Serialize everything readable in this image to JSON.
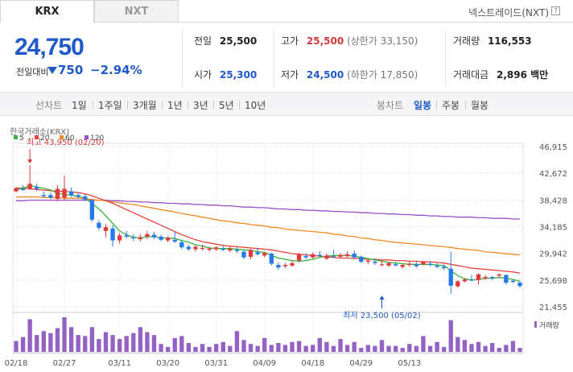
{
  "tabs": {
    "krx": "KRX",
    "nxt": "NXT"
  },
  "nxt_link": "넥스트레이드(NXT)",
  "help_icon": "?",
  "quote": {
    "price": "24,750",
    "change_label": "전일대비",
    "change": "750",
    "change_pct": "−2.94%",
    "prev_close_label": "전일",
    "prev_close": "25,500",
    "open_label": "시가",
    "open": "25,300",
    "high_label": "고가",
    "high": "25,500",
    "upper_limit": "(상한가 33,150)",
    "low_label": "저가",
    "low": "24,500",
    "lower_limit": "(하한가 17,850)",
    "volume_label": "거래량",
    "volume": "116,553",
    "amount_label": "거래대금",
    "amount": "2,896 백만"
  },
  "period_bar": {
    "line_label": "선차트",
    "line_periods": [
      "1일",
      "1주일",
      "3개월",
      "1년",
      "3년",
      "5년",
      "10년"
    ],
    "candle_label": "봉차트",
    "candle_periods": [
      "일봉",
      "주봉",
      "월봉"
    ],
    "selected_candle": "일봉"
  },
  "colors": {
    "up": "#e0393e",
    "down": "#2679e8",
    "ma5": "#37b43a",
    "ma20": "#e8443c",
    "ma60": "#f08a24",
    "ma120": "#9b4fc4",
    "volume": "#9461c4",
    "accent": "#1f5ac8"
  },
  "chart_data": {
    "type": "candlestick",
    "source_label": "한국거래소(KRX)",
    "legend": [
      {
        "label": "5",
        "color": "#37b43a"
      },
      {
        "label": "20",
        "color": "#e8443c"
      },
      {
        "label": "60",
        "color": "#f08a24"
      },
      {
        "label": "120",
        "color": "#9b4fc4"
      }
    ],
    "ylim": [
      21455,
      46915
    ],
    "y_ticks": [
      "46,915",
      "42,672",
      "38,428",
      "34,185",
      "29,942",
      "25,698",
      "21,455"
    ],
    "x_ticks": [
      {
        "label": "02/18",
        "index": 0
      },
      {
        "label": "02/27",
        "index": 7
      },
      {
        "label": "03/11",
        "index": 15
      },
      {
        "label": "03/20",
        "index": 22
      },
      {
        "label": "03/31",
        "index": 29
      },
      {
        "label": "04/09",
        "index": 36
      },
      {
        "label": "04/18",
        "index": 43
      },
      {
        "label": "04/29",
        "index": 50
      },
      {
        "label": "05/13",
        "index": 57
      }
    ],
    "high_annotation": {
      "text": "최고 43,950 (02/20)",
      "index": 2,
      "value": 43950
    },
    "low_annotation": {
      "text": "최저 23,500 (05/02)",
      "index": 53,
      "value": 23500
    },
    "volume_label": "거래량",
    "candles": [
      [
        39800,
        40500,
        39600,
        40300
      ],
      [
        40200,
        40800,
        39900,
        40000
      ],
      [
        40200,
        43950,
        40000,
        41000
      ],
      [
        40500,
        41000,
        39800,
        40200
      ],
      [
        39200,
        39800,
        38800,
        39000
      ],
      [
        39200,
        39600,
        38600,
        38800
      ],
      [
        38600,
        40800,
        38200,
        40200
      ],
      [
        38800,
        42300,
        38300,
        40200
      ],
      [
        39800,
        40400,
        38900,
        39200
      ],
      [
        39200,
        39600,
        38700,
        38900
      ],
      [
        39000,
        39400,
        38200,
        38500
      ],
      [
        38400,
        38600,
        35000,
        35300
      ],
      [
        34800,
        35200,
        33600,
        34000
      ],
      [
        33500,
        34600,
        32500,
        34100
      ],
      [
        33900,
        34400,
        31000,
        32000
      ],
      [
        32000,
        33200,
        31500,
        32800
      ],
      [
        32800,
        33500,
        32300,
        32600
      ],
      [
        32500,
        33000,
        31900,
        32400
      ],
      [
        32200,
        33000,
        31800,
        32500
      ],
      [
        32600,
        33500,
        32200,
        33000
      ],
      [
        32900,
        33400,
        32200,
        32500
      ],
      [
        32600,
        32900,
        31900,
        32100
      ],
      [
        32000,
        32700,
        31700,
        32400
      ],
      [
        32100,
        33400,
        31600,
        31800
      ],
      [
        31700,
        32100,
        30600,
        30900
      ],
      [
        31000,
        31300,
        30400,
        30600
      ],
      [
        30600,
        31200,
        30200,
        31000
      ],
      [
        30700,
        31300,
        30400,
        30800
      ],
      [
        30500,
        31000,
        30200,
        30700
      ],
      [
        30600,
        31100,
        30300,
        30900
      ],
      [
        30700,
        31200,
        30300,
        30500
      ],
      [
        30400,
        31100,
        30100,
        30700
      ],
      [
        30500,
        31000,
        30000,
        30300
      ],
      [
        30200,
        30400,
        29000,
        29300
      ],
      [
        29400,
        30700,
        29000,
        30500
      ],
      [
        30100,
        30800,
        29600,
        29800
      ],
      [
        29600,
        30200,
        29300,
        30000
      ],
      [
        29900,
        30100,
        28000,
        28300
      ],
      [
        28100,
        28500,
        27300,
        27700
      ],
      [
        27900,
        28400,
        27600,
        28100
      ],
      [
        28000,
        28700,
        27800,
        28400
      ],
      [
        28800,
        30000,
        28500,
        29800
      ],
      [
        29500,
        30000,
        29000,
        29300
      ],
      [
        29300,
        30100,
        29100,
        29800
      ],
      [
        29700,
        30300,
        29400,
        29500
      ],
      [
        29100,
        29900,
        28900,
        29600
      ],
      [
        29500,
        30500,
        29200,
        29400
      ],
      [
        29400,
        30000,
        29100,
        29700
      ],
      [
        29500,
        30300,
        29300,
        29800
      ],
      [
        29900,
        30400,
        29200,
        29300
      ],
      [
        29400,
        29600,
        28400,
        28600
      ],
      [
        28600,
        29000,
        28200,
        28800
      ],
      [
        28600,
        29100,
        28100,
        28400
      ],
      [
        28200,
        28800,
        27900,
        28200
      ],
      [
        28000,
        28600,
        27800,
        28400
      ],
      [
        28200,
        28600,
        27900,
        28000
      ],
      [
        27800,
        28300,
        27500,
        28100
      ],
      [
        28100,
        28700,
        27800,
        28300
      ],
      [
        28200,
        28600,
        27700,
        27900
      ],
      [
        28200,
        28800,
        28000,
        28600
      ],
      [
        28300,
        28700,
        27900,
        28100
      ],
      [
        28000,
        28400,
        27600,
        27800
      ],
      [
        27800,
        28200,
        27300,
        27600
      ],
      [
        27500,
        30200,
        23500,
        24800
      ],
      [
        24700,
        25700,
        24500,
        25500
      ],
      [
        25500,
        26000,
        25300,
        25800
      ],
      [
        25800,
        26500,
        25500,
        25700
      ],
      [
        25700,
        26800,
        25000,
        26600
      ],
      [
        26000,
        26500,
        25700,
        26200
      ],
      [
        26200,
        26300,
        25700,
        26000
      ],
      [
        26400,
        26800,
        26000,
        26600
      ],
      [
        26500,
        26600,
        25000,
        25300
      ],
      [
        25600,
        25700,
        25200,
        25400
      ],
      [
        25300,
        25500,
        24500,
        24750
      ]
    ],
    "ma5": [
      40100,
      40300,
      40700,
      40500,
      40300,
      40000,
      39500,
      39300,
      39200,
      39000,
      38700,
      37900,
      37000,
      35900,
      34700,
      33500,
      32900,
      32500,
      32400,
      32600,
      32600,
      32400,
      32400,
      32300,
      32000,
      31700,
      31300,
      31100,
      30800,
      30700,
      30700,
      30700,
      30600,
      30500,
      30400,
      30200,
      30100,
      29600,
      29200,
      29000,
      28800,
      28700,
      28800,
      29000,
      29300,
      29500,
      29600,
      29600,
      29600,
      29500,
      29300,
      29100,
      28900,
      28700,
      28500,
      28400,
      28300,
      28200,
      28200,
      28200,
      28200,
      28100,
      28000,
      27200,
      26400,
      25900,
      25700,
      25800,
      26000,
      26000,
      26100,
      26000,
      25800,
      25500
    ],
    "ma20": [
      40300,
      40300,
      40200,
      40100,
      40000,
      39900,
      39800,
      39800,
      39700,
      39600,
      39400,
      39100,
      38700,
      38300,
      37900,
      37400,
      36900,
      36400,
      35900,
      35400,
      34900,
      34400,
      33900,
      33400,
      32900,
      32500,
      32100,
      31800,
      31600,
      31400,
      31200,
      31100,
      31000,
      30900,
      30800,
      30700,
      30600,
      30500,
      30300,
      30100,
      29900,
      29800,
      29700,
      29600,
      29500,
      29400,
      29300,
      29200,
      29200,
      29100,
      29100,
      29000,
      29000,
      28900,
      28900,
      28800,
      28800,
      28700,
      28700,
      28600,
      28600,
      28500,
      28400,
      28200,
      28000,
      27800,
      27600,
      27500,
      27400,
      27300,
      27200,
      27100,
      27000,
      26800
    ],
    "ma60": [
      38900,
      38900,
      38900,
      38900,
      38800,
      38800,
      38800,
      38700,
      38700,
      38700,
      38600,
      38500,
      38400,
      38300,
      38100,
      38000,
      37800,
      37700,
      37500,
      37300,
      37100,
      36900,
      36700,
      36500,
      36300,
      36100,
      35900,
      35700,
      35500,
      35300,
      35100,
      35000,
      34800,
      34700,
      34500,
      34400,
      34300,
      34100,
      34000,
      33800,
      33700,
      33600,
      33500,
      33400,
      33300,
      33200,
      33000,
      32900,
      32700,
      32600,
      32400,
      32300,
      32100,
      32000,
      31800,
      31700,
      31600,
      31500,
      31400,
      31300,
      31200,
      31100,
      31000,
      30900,
      30700,
      30600,
      30500,
      30400,
      30200,
      30100,
      30000,
      29900,
      29800,
      29700
    ],
    "ma120": [
      38300,
      38300,
      38400,
      38400,
      38400,
      38400,
      38400,
      38400,
      38400,
      38400,
      38400,
      38400,
      38400,
      38400,
      38300,
      38300,
      38200,
      38200,
      38100,
      38100,
      38000,
      38000,
      37900,
      37900,
      37800,
      37800,
      37700,
      37700,
      37600,
      37600,
      37500,
      37500,
      37400,
      37300,
      37300,
      37200,
      37200,
      37100,
      37000,
      37000,
      36900,
      36900,
      36800,
      36800,
      36700,
      36700,
      36600,
      36600,
      36500,
      36500,
      36400,
      36400,
      36300,
      36300,
      36200,
      36200,
      36100,
      36100,
      36000,
      36000,
      35900,
      35900,
      35800,
      35800,
      35700,
      35700,
      35700,
      35600,
      35600,
      35500,
      35500,
      35500,
      35400,
      35400
    ],
    "volume": [
      110,
      150,
      330,
      170,
      210,
      190,
      240,
      350,
      250,
      170,
      160,
      250,
      130,
      200,
      170,
      130,
      160,
      190,
      250,
      200,
      170,
      80,
      50,
      140,
      160,
      90,
      50,
      80,
      50,
      80,
      100,
      60,
      210,
      120,
      80,
      60,
      140,
      70,
      90,
      70,
      100,
      110,
      60,
      70,
      140,
      100,
      60,
      130,
      70,
      100,
      40,
      70,
      60,
      120,
      60,
      60,
      40,
      80,
      60,
      160,
      60,
      100,
      50,
      320,
      150,
      120,
      80,
      100,
      60,
      90,
      40,
      70,
      110,
      40
    ]
  }
}
